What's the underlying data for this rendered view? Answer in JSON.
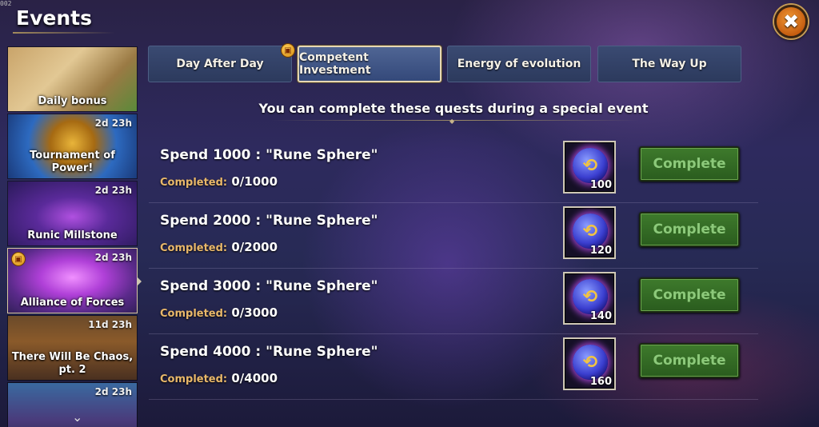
{
  "version": "002",
  "header": {
    "title": "Events",
    "close_icon": "✖"
  },
  "sidebar": {
    "items": [
      {
        "label": "Daily bonus",
        "timer": ""
      },
      {
        "label": "Tournament of Power!",
        "timer": "2d 23h"
      },
      {
        "label": "Runic Millstone",
        "timer": "2d 23h"
      },
      {
        "label": "Alliance of Forces",
        "timer": "2d 23h"
      },
      {
        "label": "There Will Be Chaos, pt. 2",
        "timer": "11d 23h"
      },
      {
        "label": "",
        "timer": "2d 23h"
      }
    ],
    "scroll_icon": "⌄"
  },
  "tabs": [
    {
      "label": "Day After Day"
    },
    {
      "label": "Competent Investment"
    },
    {
      "label": "Energy of evolution"
    },
    {
      "label": "The Way Up"
    }
  ],
  "event_info": "You can complete these quests during a special event",
  "quests": [
    {
      "title": "Spend 1000 : \"Rune Sphere\"",
      "completed_label": "Completed:",
      "progress": "0/1000",
      "reward_qty": "100",
      "button": "Complete"
    },
    {
      "title": "Spend 2000 : \"Rune Sphere\"",
      "completed_label": "Completed:",
      "progress": "0/2000",
      "reward_qty": "120",
      "button": "Complete"
    },
    {
      "title": "Spend 3000 : \"Rune Sphere\"",
      "completed_label": "Completed:",
      "progress": "0/3000",
      "reward_qty": "140",
      "button": "Complete"
    },
    {
      "title": "Spend 4000 : \"Rune Sphere\"",
      "completed_label": "Completed:",
      "progress": "0/4000",
      "reward_qty": "160",
      "button": "Complete"
    }
  ],
  "colors": {
    "complete_button": "#2f6a22",
    "completed_label": "#e9b86a",
    "close_button": "#e07a20"
  }
}
